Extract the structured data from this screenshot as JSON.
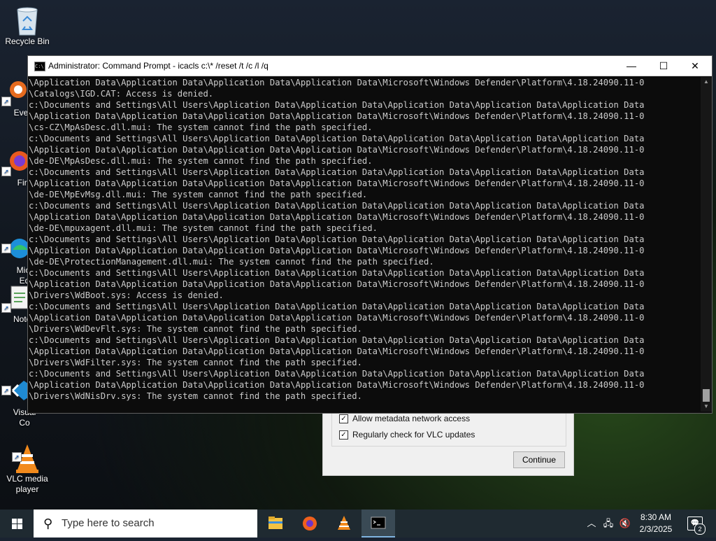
{
  "desktop": {
    "icons": [
      {
        "label": "Recycle Bin",
        "name": "recycle-bin-icon"
      },
      {
        "label": "Every",
        "name": "everything-icon"
      },
      {
        "label": "Fire",
        "name": "firefox-icon"
      },
      {
        "label": "Micr\nEd",
        "name": "edge-icon"
      },
      {
        "label": "Notep",
        "name": "notepad-icon"
      },
      {
        "label": "Visual\nCo",
        "name": "vscode-icon"
      },
      {
        "label": "VLC media\nplayer",
        "name": "vlc-icon"
      }
    ]
  },
  "vlc_dialog": {
    "check_metadata": "Allow metadata network access",
    "check_updates": "Regularly check for VLC updates",
    "continue_label": "Continue"
  },
  "console": {
    "title": "Administrator: Command Prompt - icacls  c:\\* /reset /t /c /l /q",
    "minimize": "—",
    "maximize": "☐",
    "close": "✕",
    "lines": [
      "\\Application Data\\Application Data\\Application Data\\Application Data\\Microsoft\\Windows Defender\\Platform\\4.18.24090.11-0",
      "\\Catalogs\\IGD.CAT: Access is denied.",
      "c:\\Documents and Settings\\All Users\\Application Data\\Application Data\\Application Data\\Application Data\\Application Data",
      "\\Application Data\\Application Data\\Application Data\\Application Data\\Microsoft\\Windows Defender\\Platform\\4.18.24090.11-0",
      "\\cs-CZ\\MpAsDesc.dll.mui: The system cannot find the path specified.",
      "c:\\Documents and Settings\\All Users\\Application Data\\Application Data\\Application Data\\Application Data\\Application Data",
      "\\Application Data\\Application Data\\Application Data\\Application Data\\Microsoft\\Windows Defender\\Platform\\4.18.24090.11-0",
      "\\de-DE\\MpAsDesc.dll.mui: The system cannot find the path specified.",
      "c:\\Documents and Settings\\All Users\\Application Data\\Application Data\\Application Data\\Application Data\\Application Data",
      "\\Application Data\\Application Data\\Application Data\\Application Data\\Microsoft\\Windows Defender\\Platform\\4.18.24090.11-0",
      "\\de-DE\\MpEvMsg.dll.mui: The system cannot find the path specified.",
      "c:\\Documents and Settings\\All Users\\Application Data\\Application Data\\Application Data\\Application Data\\Application Data",
      "\\Application Data\\Application Data\\Application Data\\Application Data\\Microsoft\\Windows Defender\\Platform\\4.18.24090.11-0",
      "\\de-DE\\mpuxagent.dll.mui: The system cannot find the path specified.",
      "c:\\Documents and Settings\\All Users\\Application Data\\Application Data\\Application Data\\Application Data\\Application Data",
      "\\Application Data\\Application Data\\Application Data\\Application Data\\Microsoft\\Windows Defender\\Platform\\4.18.24090.11-0",
      "\\de-DE\\ProtectionManagement.dll.mui: The system cannot find the path specified.",
      "c:\\Documents and Settings\\All Users\\Application Data\\Application Data\\Application Data\\Application Data\\Application Data",
      "\\Application Data\\Application Data\\Application Data\\Application Data\\Microsoft\\Windows Defender\\Platform\\4.18.24090.11-0",
      "\\Drivers\\WdBoot.sys: Access is denied.",
      "c:\\Documents and Settings\\All Users\\Application Data\\Application Data\\Application Data\\Application Data\\Application Data",
      "\\Application Data\\Application Data\\Application Data\\Application Data\\Microsoft\\Windows Defender\\Platform\\4.18.24090.11-0",
      "\\Drivers\\WdDevFlt.sys: The system cannot find the path specified.",
      "c:\\Documents and Settings\\All Users\\Application Data\\Application Data\\Application Data\\Application Data\\Application Data",
      "\\Application Data\\Application Data\\Application Data\\Application Data\\Microsoft\\Windows Defender\\Platform\\4.18.24090.11-0",
      "\\Drivers\\WdFilter.sys: The system cannot find the path specified.",
      "c:\\Documents and Settings\\All Users\\Application Data\\Application Data\\Application Data\\Application Data\\Application Data",
      "\\Application Data\\Application Data\\Application Data\\Application Data\\Microsoft\\Windows Defender\\Platform\\4.18.24090.11-0",
      "\\Drivers\\WdNisDrv.sys: The system cannot find the path specified."
    ]
  },
  "taskbar": {
    "search_placeholder": "Type here to search",
    "apps": [
      "file-explorer-icon",
      "firefox-icon",
      "vlc-icon",
      "command-prompt-icon"
    ],
    "time": "8:30 AM",
    "date": "2/3/2025",
    "notification_count": "2"
  }
}
